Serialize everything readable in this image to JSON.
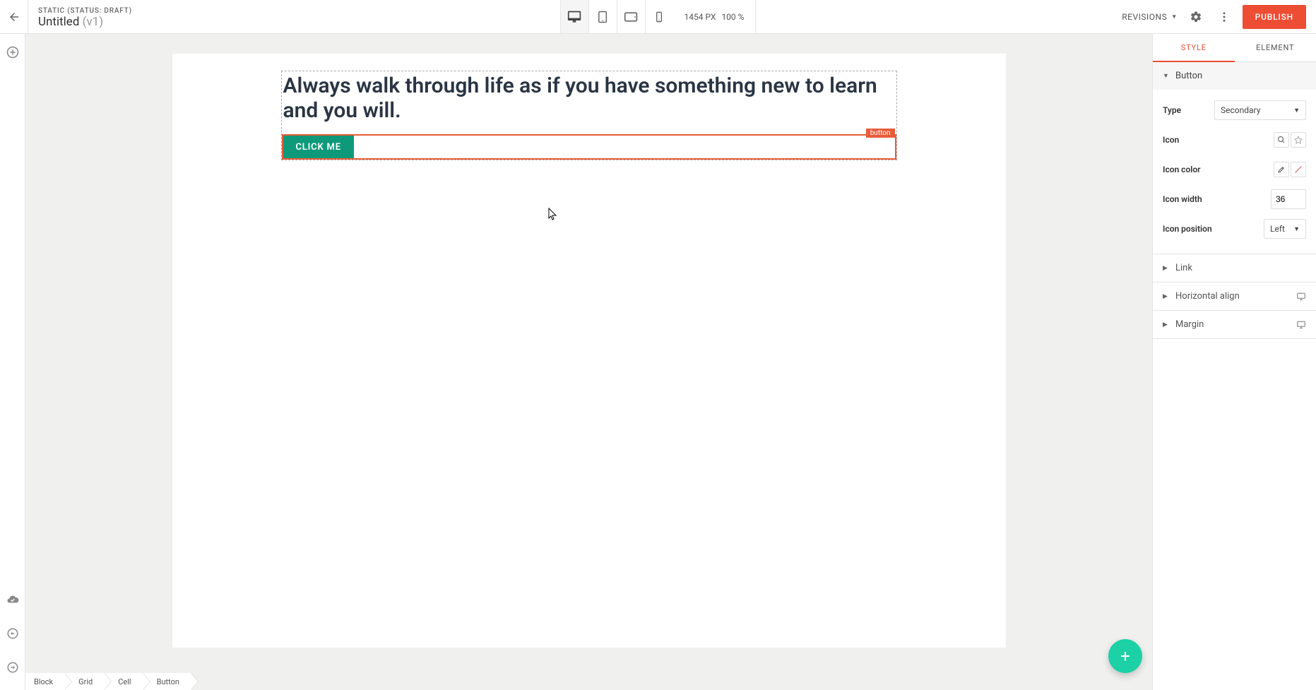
{
  "header": {
    "status_line": "STATIC (STATUS: DRAFT)",
    "title": "Untitled",
    "version": "(v1)",
    "zoom_px": "1454 PX",
    "zoom_pct": "100 %",
    "revisions_label": "REVISIONS",
    "publish_label": "PUBLISH"
  },
  "canvas": {
    "heading": "Always walk through life as if you have something new to learn and you will.",
    "selected_tag": "button",
    "button_label": "CLICK ME"
  },
  "breadcrumbs": [
    "Block",
    "Grid",
    "Cell",
    "Button"
  ],
  "right_panel": {
    "tabs": {
      "style": "STYLE",
      "element": "ELEMENT"
    },
    "section_button_title": "Button",
    "type_label": "Type",
    "type_value": "Secondary",
    "icon_label": "Icon",
    "icon_color_label": "Icon color",
    "icon_width_label": "Icon width",
    "icon_width_value": "36",
    "icon_position_label": "Icon position",
    "icon_position_value": "Left",
    "link_title": "Link",
    "h_align_title": "Horizontal align",
    "margin_title": "Margin"
  }
}
